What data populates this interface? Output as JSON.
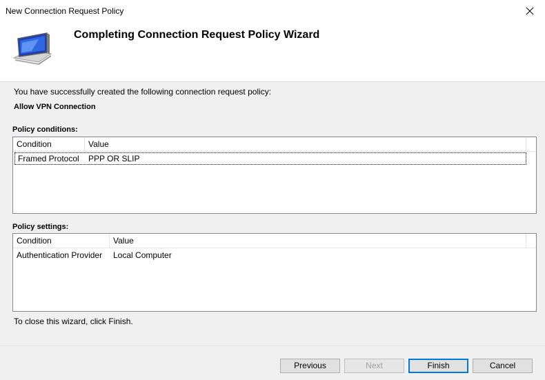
{
  "window": {
    "title": "New Connection Request Policy"
  },
  "header": {
    "title": "Completing Connection Request Policy Wizard"
  },
  "content": {
    "summary": "You have successfully created the following connection request policy:",
    "policy_name": "Allow VPN Connection",
    "conditions": {
      "label": "Policy conditions:",
      "columns": [
        "Condition",
        "Value"
      ],
      "rows": [
        {
          "condition": "Framed Protocol",
          "value": "PPP OR SLIP"
        }
      ]
    },
    "settings": {
      "label": "Policy settings:",
      "columns": [
        "Condition",
        "Value"
      ],
      "rows": [
        {
          "condition": "Authentication Provider",
          "value": "Local Computer"
        }
      ]
    },
    "close_instruction": "To close this wizard, click Finish."
  },
  "buttons": {
    "previous": "Previous",
    "next": "Next",
    "finish": "Finish",
    "cancel": "Cancel"
  },
  "icons": {
    "close": "close-icon",
    "wizard": "monitor-icon"
  }
}
